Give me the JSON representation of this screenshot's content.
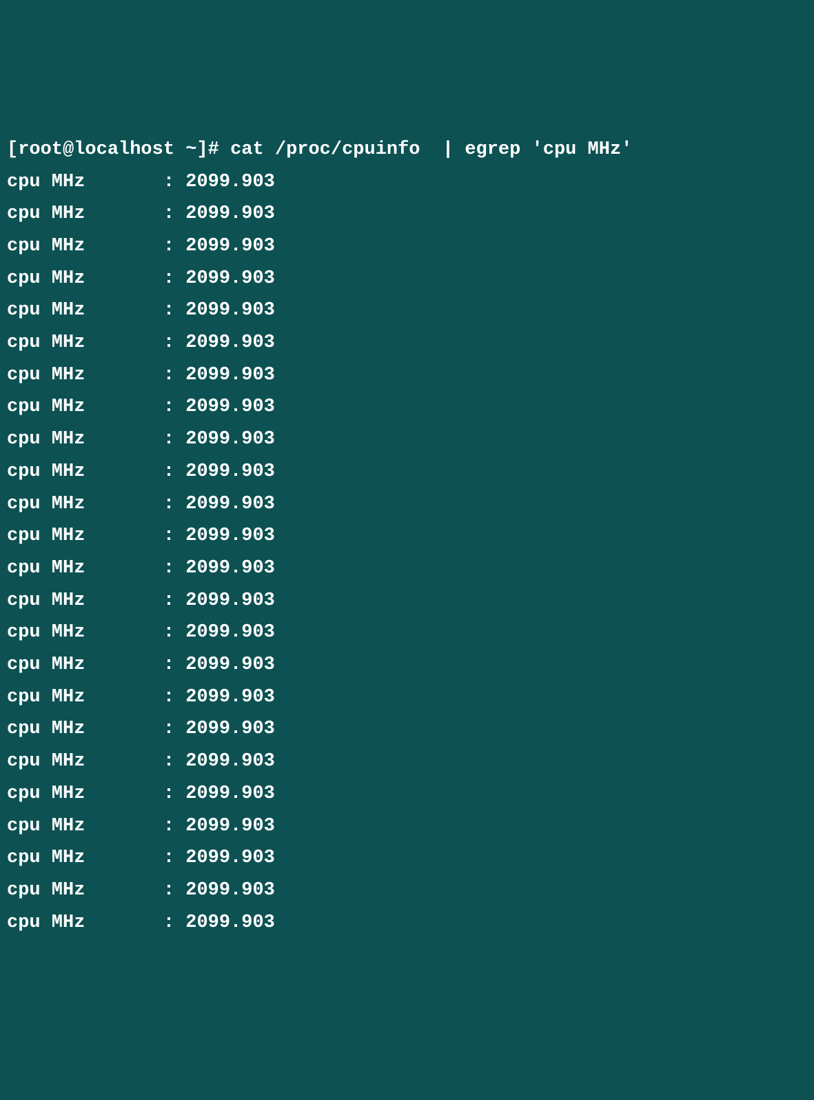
{
  "prompt": "[root@localhost ~]# ",
  "command": "cat /proc/cpuinfo  | egrep 'cpu MHz'",
  "output_lines": [
    {
      "key": "cpu MHz",
      "sep": ": ",
      "value": "2099.903"
    },
    {
      "key": "cpu MHz",
      "sep": ": ",
      "value": "2099.903"
    },
    {
      "key": "cpu MHz",
      "sep": ": ",
      "value": "2099.903"
    },
    {
      "key": "cpu MHz",
      "sep": ": ",
      "value": "2099.903"
    },
    {
      "key": "cpu MHz",
      "sep": ": ",
      "value": "2099.903"
    },
    {
      "key": "cpu MHz",
      "sep": ": ",
      "value": "2099.903"
    },
    {
      "key": "cpu MHz",
      "sep": ": ",
      "value": "2099.903"
    },
    {
      "key": "cpu MHz",
      "sep": ": ",
      "value": "2099.903"
    },
    {
      "key": "cpu MHz",
      "sep": ": ",
      "value": "2099.903"
    },
    {
      "key": "cpu MHz",
      "sep": ": ",
      "value": "2099.903"
    },
    {
      "key": "cpu MHz",
      "sep": ": ",
      "value": "2099.903"
    },
    {
      "key": "cpu MHz",
      "sep": ": ",
      "value": "2099.903"
    },
    {
      "key": "cpu MHz",
      "sep": ": ",
      "value": "2099.903"
    },
    {
      "key": "cpu MHz",
      "sep": ": ",
      "value": "2099.903"
    },
    {
      "key": "cpu MHz",
      "sep": ": ",
      "value": "2099.903"
    },
    {
      "key": "cpu MHz",
      "sep": ": ",
      "value": "2099.903"
    },
    {
      "key": "cpu MHz",
      "sep": ": ",
      "value": "2099.903"
    },
    {
      "key": "cpu MHz",
      "sep": ": ",
      "value": "2099.903"
    },
    {
      "key": "cpu MHz",
      "sep": ": ",
      "value": "2099.903"
    },
    {
      "key": "cpu MHz",
      "sep": ": ",
      "value": "2099.903"
    },
    {
      "key": "cpu MHz",
      "sep": ": ",
      "value": "2099.903"
    },
    {
      "key": "cpu MHz",
      "sep": ": ",
      "value": "2099.903"
    },
    {
      "key": "cpu MHz",
      "sep": ": ",
      "value": "2099.903"
    },
    {
      "key": "cpu MHz",
      "sep": ": ",
      "value": "2099.903"
    }
  ]
}
